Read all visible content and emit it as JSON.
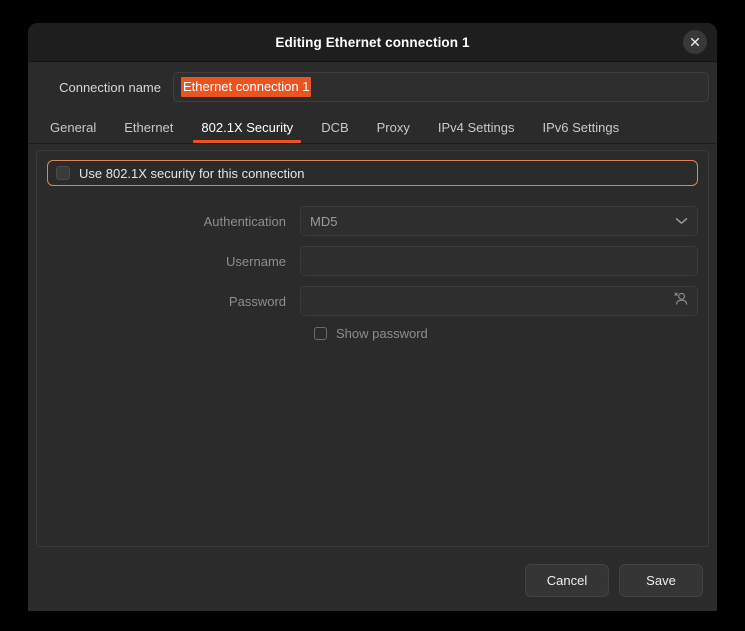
{
  "window": {
    "title": "Editing Ethernet connection 1",
    "close_icon": "close-icon"
  },
  "connection": {
    "label": "Connection name",
    "value": "Ethernet connection 1"
  },
  "tabs": [
    {
      "label": "General",
      "active": false
    },
    {
      "label": "Ethernet",
      "active": false
    },
    {
      "label": "802.1X Security",
      "active": true
    },
    {
      "label": "DCB",
      "active": false
    },
    {
      "label": "Proxy",
      "active": false
    },
    {
      "label": "IPv4 Settings",
      "active": false
    },
    {
      "label": "IPv6 Settings",
      "active": false
    }
  ],
  "security": {
    "enable_label": "Use 802.1X security for this connection",
    "enable_checked": false,
    "authentication": {
      "label": "Authentication",
      "value": "MD5",
      "chevron_icon": "chevron-down-icon"
    },
    "username": {
      "label": "Username",
      "value": "",
      "placeholder": ""
    },
    "password": {
      "label": "Password",
      "value": "",
      "placeholder": "",
      "icon": "user-account-icon"
    },
    "show_password": {
      "label": "Show password",
      "checked": false
    }
  },
  "footer": {
    "cancel_label": "Cancel",
    "save_label": "Save"
  },
  "colors": {
    "accent": "#e95420",
    "focus_ring": "#e0845c",
    "window_bg": "#2b2b2b",
    "titlebar_bg": "#1e1e1e",
    "desktop_bg": "#000000"
  }
}
